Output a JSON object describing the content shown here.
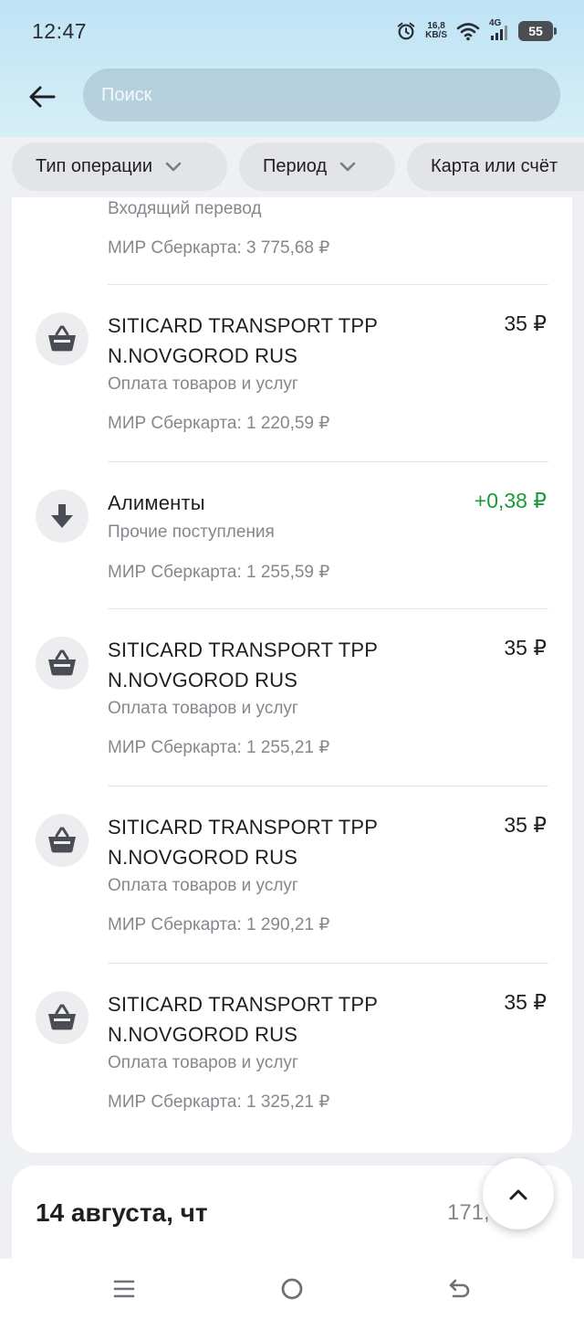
{
  "status_bar": {
    "time": "12:47",
    "net_speed_value": "16,8",
    "net_speed_unit": "KB/S",
    "network": "4G",
    "battery": "55"
  },
  "header": {
    "search_placeholder": "Поиск"
  },
  "filters": [
    {
      "label": "Тип операции"
    },
    {
      "label": "Период"
    },
    {
      "label": "Карта или счёт"
    }
  ],
  "transactions": [
    {
      "title": "",
      "category": "Входящий перевод",
      "account": "МИР Сберкарта: 3 775,68 ₽",
      "amount": "",
      "icon": "partial"
    },
    {
      "title": "SITICARD TRANSPORT TPP N.NOVGOROD RUS",
      "category": "Оплата товаров и услуг",
      "account": "МИР Сберкарта: 1 220,59 ₽",
      "amount": "35 ₽",
      "icon": "basket-icon"
    },
    {
      "title": "Алименты",
      "category": "Прочие поступления",
      "account": "МИР Сберкарта: 1 255,59 ₽",
      "amount": "+0,38 ₽",
      "icon": "arrow-down-icon"
    },
    {
      "title": "SITICARD TRANSPORT TPP N.NOVGOROD RUS",
      "category": "Оплата товаров и услуг",
      "account": "МИР Сберкарта: 1 255,21 ₽",
      "amount": "35 ₽",
      "icon": "basket-icon"
    },
    {
      "title": "SITICARD TRANSPORT TPP N.NOVGOROD RUS",
      "category": "Оплата товаров и услуг",
      "account": "МИР Сберкарта: 1 290,21 ₽",
      "amount": "35 ₽",
      "icon": "basket-icon"
    },
    {
      "title": "SITICARD TRANSPORT TPP N.NOVGOROD RUS",
      "category": "Оплата товаров и услуг",
      "account": "МИР Сберкарта: 1 325,21 ₽",
      "amount": "35 ₽",
      "icon": "basket-icon"
    }
  ],
  "next_day": {
    "title": "14 августа, чт",
    "sum": "171,"
  },
  "colors": {
    "income": "#1a9b3a",
    "header_gradient_top": "#bfe3f6",
    "secondary_text": "#85878d"
  }
}
